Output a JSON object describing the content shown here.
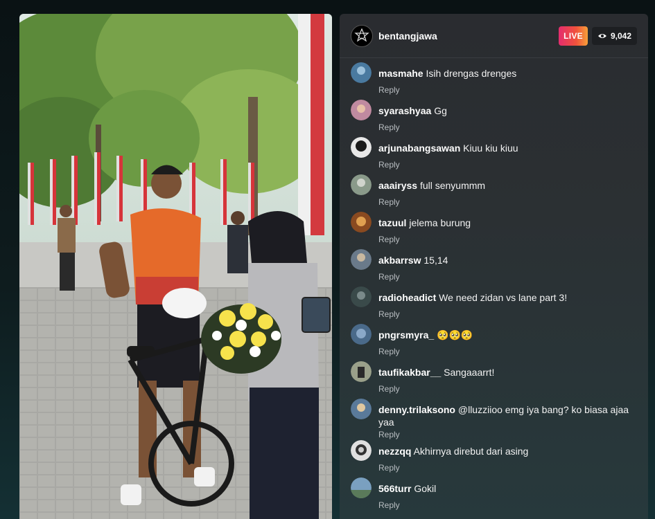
{
  "stream": {
    "host_name": "bentangjawa",
    "live_label": "LIVE",
    "viewer_count": "9,042",
    "live_gradient": [
      "#e42d6e",
      "#f7a03a"
    ]
  },
  "comments": [
    {
      "user": "masmahe",
      "text": "Isih drengas drenges",
      "reply": "Reply",
      "avatar_color": "#4a7aa0"
    },
    {
      "user": "syarashyaa",
      "text": "Gg",
      "reply": "Reply",
      "avatar_color": "#c08aa0"
    },
    {
      "user": "arjunabangsawan",
      "text": "Kiuu kiu kiuu",
      "reply": "Reply",
      "avatar_color": "#2a2a2a"
    },
    {
      "user": "aaairyss",
      "text": "full senyummm",
      "reply": "Reply",
      "avatar_color": "#8a9a8a"
    },
    {
      "user": "tazuul",
      "text": "jelema burung",
      "reply": "Reply",
      "avatar_color": "#8a4a20"
    },
    {
      "user": "akbarrsw",
      "text": "15,14",
      "reply": "Reply",
      "avatar_color": "#6a7a8a"
    },
    {
      "user": "radioheadict",
      "text": "We need zidan vs lane part 3!",
      "reply": "Reply",
      "avatar_color": "#3a4a4a"
    },
    {
      "user": "pngrsmyra_",
      "text": "🥺🥺🥺",
      "reply": "Reply",
      "avatar_color": "#4a6a8a"
    },
    {
      "user": "taufikakbar__",
      "text": "Sangaaarrt!",
      "reply": "Reply",
      "avatar_color": "#9aa08a"
    },
    {
      "user": "denny.trilaksono",
      "text": "@lluzziioo emg iya bang? ko biasa ajaa yaa",
      "reply": "Reply",
      "avatar_color": "#5a7a9a"
    },
    {
      "user": "nezzqq",
      "text": "Akhirnya direbut dari asing",
      "reply": "Reply",
      "avatar_color": "#e0e0e0"
    },
    {
      "user": "566turr",
      "text": "Gokil",
      "reply": "Reply",
      "avatar_color": "#7aa0c0"
    }
  ]
}
